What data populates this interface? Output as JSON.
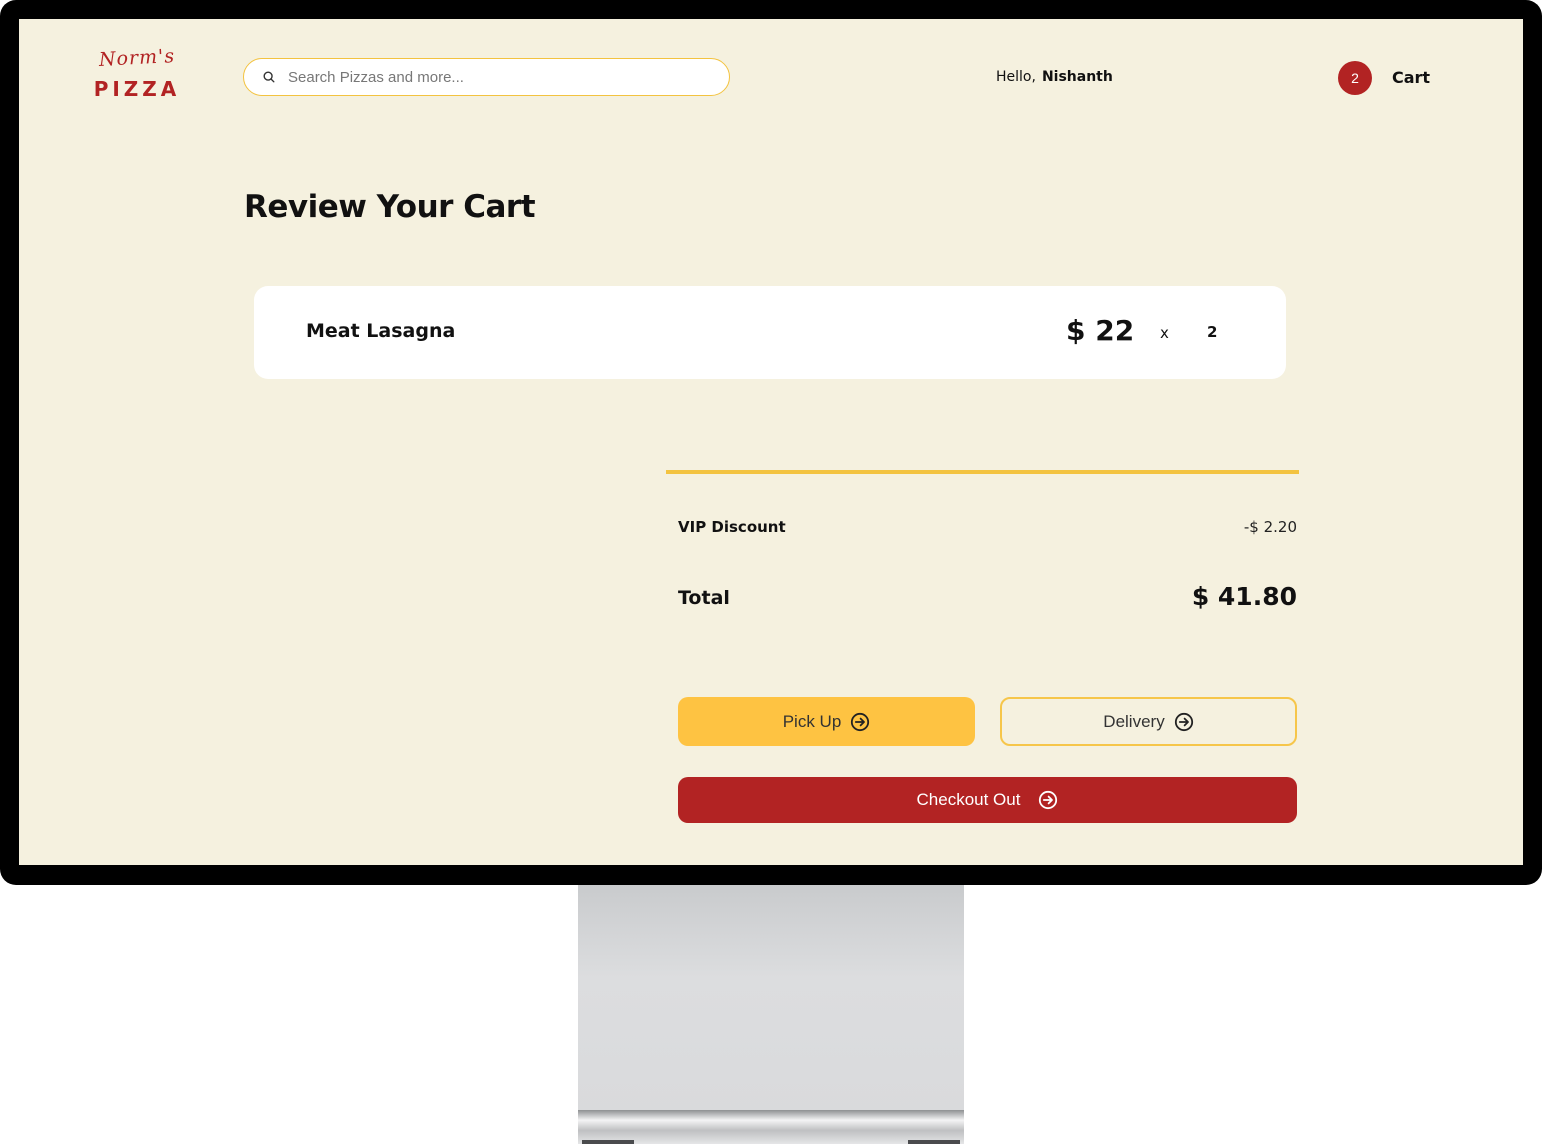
{
  "brand": {
    "script": "Norm's",
    "main": "PIZZA",
    "color": "#b22323"
  },
  "search": {
    "placeholder": "Search Pizzas and more..."
  },
  "user": {
    "greeting": "Hello,",
    "name": "Nishanth"
  },
  "cart": {
    "count": "2",
    "label": "Cart"
  },
  "page": {
    "title": "Review Your Cart"
  },
  "items": [
    {
      "name": "Meat Lasagna",
      "price": "$ 22",
      "multiplier": "x",
      "quantity": "2"
    }
  ],
  "summary": {
    "discount_label": "VIP Discount",
    "discount_value": "-$ 2.20",
    "total_label": "Total",
    "total_value": "$ 41.80"
  },
  "actions": {
    "pickup_label": "Pick Up",
    "delivery_label": "Delivery",
    "checkout_label": "Checkout Out"
  },
  "colors": {
    "background": "#f5f1df",
    "accent_yellow": "#fec342",
    "brand_red": "#b22323"
  }
}
